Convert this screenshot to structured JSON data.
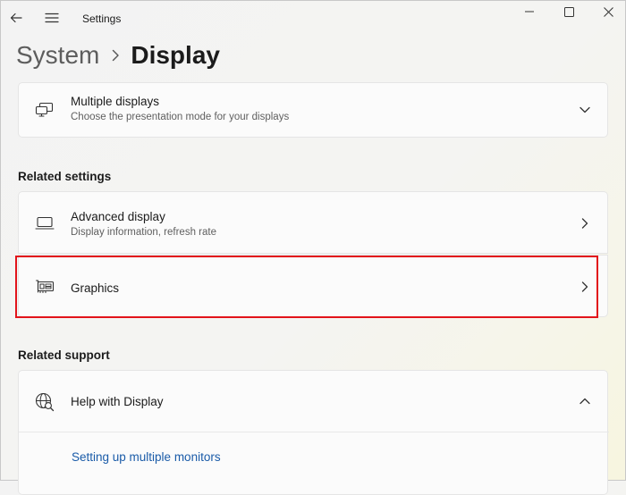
{
  "window": {
    "title": "Settings"
  },
  "breadcrumb": {
    "parent": "System",
    "current": "Display"
  },
  "multiple_displays": {
    "title": "Multiple displays",
    "subtitle": "Choose the presentation mode for your displays",
    "icon": "multiple-displays-icon"
  },
  "related_settings": {
    "label": "Related settings",
    "items": [
      {
        "title": "Advanced display",
        "subtitle": "Display information, refresh rate",
        "icon": "monitor-icon"
      },
      {
        "title": "Graphics",
        "subtitle": "",
        "icon": "graphics-card-icon"
      }
    ]
  },
  "related_support": {
    "label": "Related support",
    "help": {
      "title": "Help with Display",
      "icon": "globe-search-icon",
      "links": [
        "Setting up multiple monitors"
      ]
    }
  },
  "colors": {
    "highlight": "#e2131a",
    "link": "#1a5ba8"
  }
}
